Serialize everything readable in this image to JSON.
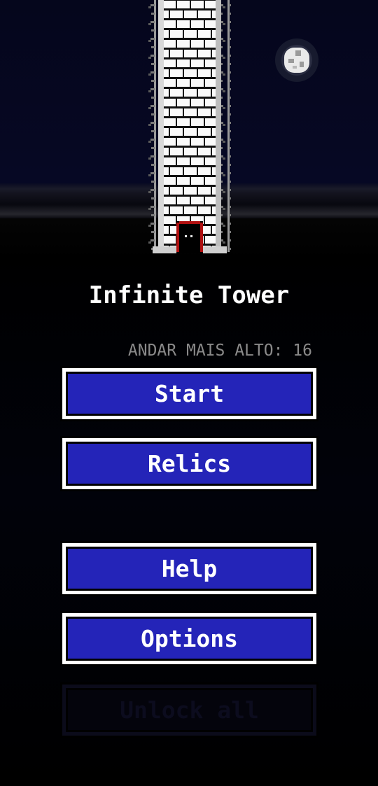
{
  "game": {
    "title": "Infinite Tower",
    "highscore_text": "ANDAR MAIS ALTO: 16"
  },
  "menu": {
    "start_label": "Start",
    "relics_label": "Relics",
    "help_label": "Help",
    "options_label": "Options",
    "unlock_label": "Unlock all"
  },
  "colors": {
    "button_fill": "#2424b8",
    "button_border": "#ffffff",
    "highscore_text": "#8a8a8a",
    "door_red": "#b01010"
  },
  "scene": {
    "icons": [
      "tower-icon",
      "moon-icon",
      "door-icon"
    ]
  }
}
